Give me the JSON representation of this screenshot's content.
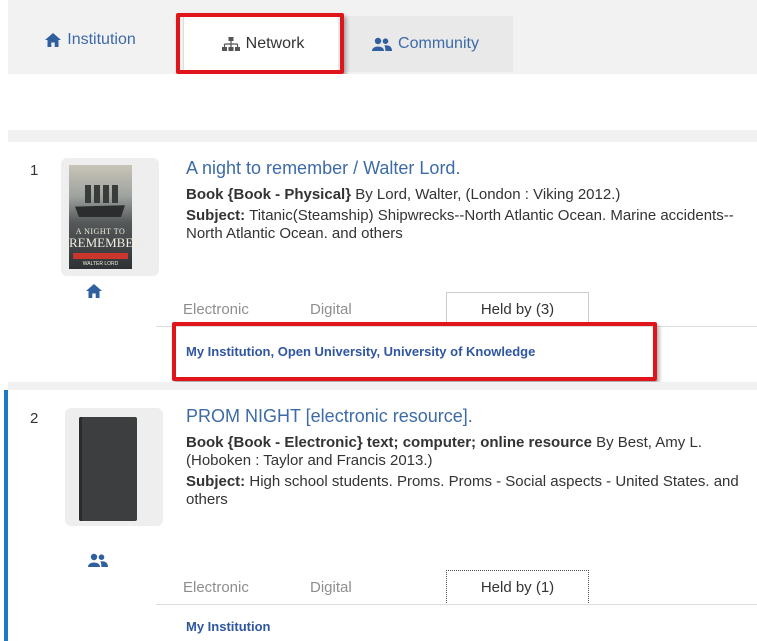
{
  "tabs": [
    {
      "label": "Institution",
      "icon": "home-icon"
    },
    {
      "label": "Network",
      "icon": "sitemap-icon",
      "selected": true
    },
    {
      "label": "Community",
      "icon": "users-icon"
    }
  ],
  "results": [
    {
      "number": "1",
      "title": "A night to remember / Walter Lord.",
      "format_label": "Book {Book - Physical}",
      "format_rest": " By Lord, Walter, (London : Viking 2012.)",
      "subject_label": "Subject:",
      "subject_text": " Titanic(Steamship) Shipwrecks--North Atlantic Ocean. Marine accidents--North Atlantic Ocean. and others",
      "cover": {
        "line1": "A NIGHT TO",
        "line2": "REMEMBER",
        "author": "WALTER LORD"
      },
      "type_icon": "home-icon",
      "subtabs": [
        "Electronic",
        "Digital",
        "Held by (3)"
      ],
      "holdings": "My Institution, Open University, University of Knowledge"
    },
    {
      "number": "2",
      "title": "PROM NIGHT [electronic resource].",
      "format_label": "Book {Book - Electronic} text; computer; online resource",
      "format_rest": " By Best, Amy L. (Hoboken : Taylor and Francis 2013.)",
      "subject_label": "Subject:",
      "subject_text": " High school students. Proms. Proms - Social aspects - United States. and others",
      "type_icon": "users-icon",
      "subtabs": [
        "Electronic",
        "Digital",
        "Held by (1)"
      ],
      "holdings": "My Institution"
    }
  ],
  "colors": {
    "link": "#3d6aa8",
    "highlight": "#e0151b",
    "accent": "#1e78c8"
  }
}
